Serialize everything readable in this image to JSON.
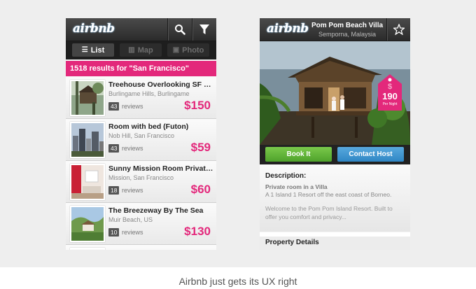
{
  "brand": {
    "logo_text": "airbnb",
    "accent_color": "#e3287b",
    "book_color": "#5fb236",
    "contact_color": "#3b92d1"
  },
  "list_screen": {
    "tabs": [
      {
        "label": "List",
        "icon": "list-icon",
        "active": true
      },
      {
        "label": "Map",
        "icon": "map-icon",
        "active": false
      },
      {
        "label": "Photo",
        "icon": "photo-icon",
        "active": false
      }
    ],
    "results_text": "1518 results for \"San Francisco\"",
    "listings": [
      {
        "title": "Treehouse Overlooking SF bay",
        "location": "Burlingame Hills, Burlingame",
        "reviews_count": "43",
        "reviews_label": "reviews",
        "price": "$150"
      },
      {
        "title": "Room with bed (Futon)",
        "location": "Nob Hill, San Francisco",
        "reviews_count": "43",
        "reviews_label": "reviews",
        "price": "$59"
      },
      {
        "title": "Sunny Mission Room Private...",
        "location": "Mission, San Francisco",
        "reviews_count": "18",
        "reviews_label": "reviews",
        "price": "$60"
      },
      {
        "title": "The Breezeway By The Sea",
        "location": "Muir Beach, US",
        "reviews_count": "10",
        "reviews_label": "reviews",
        "price": "$130"
      }
    ]
  },
  "detail_screen": {
    "title": "Pom Pom Beach Villa",
    "subtitle": "Semporna, Malaysia",
    "price_tag": {
      "currency": "$",
      "amount": "190",
      "period": "Per Night"
    },
    "book_label": "Book It",
    "contact_label": "Contact Host",
    "description_heading": "Description:",
    "description_title": "Private room in a Villa",
    "description_line1": "A 1 Island 1 Resort off the east coast of Borneo.",
    "description_line2": "Welcome to the Pom Pom Island Resort. Built to",
    "description_line3": "offer you comfort and privacy...",
    "property_heading": "Property Details"
  },
  "caption": "Airbnb just gets its UX right"
}
